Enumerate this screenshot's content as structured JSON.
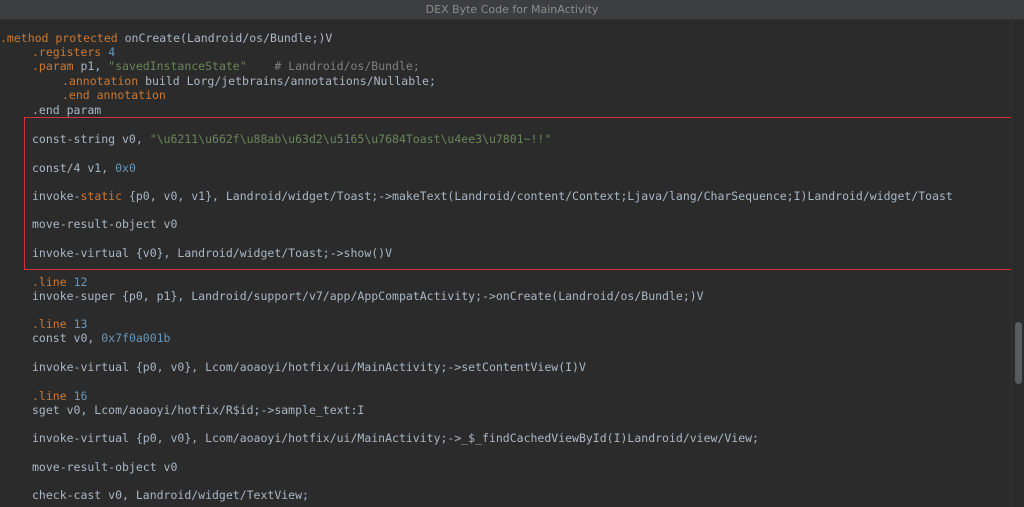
{
  "window": {
    "title": "DEX Byte Code for MainActivity"
  },
  "code": {
    "l1": {
      "dir": ".method protected",
      "rest": " onCreate(Landroid/os/Bundle;)V"
    },
    "l2": {
      "dir": ".registers",
      "num": "4"
    },
    "l3": {
      "dir": ".param",
      "rest": " p1, ",
      "str": "\"savedInstanceState\"",
      "cmt": "    # Landroid/os/Bundle;"
    },
    "l4": {
      "dir": ".annotation",
      "rest": " build Lorg/jetbrains/annotations/Nullable;"
    },
    "l5": {
      "dir": ".end annotation"
    },
    "l6": {
      "text": ".end param"
    },
    "l7": {
      "rest": "const-string v0, ",
      "str": "\"\\u6211\\u662f\\u88ab\\u63d2\\u5165\\u7684Toast\\u4ee3\\u7801~!!\""
    },
    "l8": {
      "rest": "const/4 v1, ",
      "num": "0x0"
    },
    "l9": {
      "pre": "invoke-",
      "kw": "static",
      "rest": " {p0, v0, v1}, Landroid/widget/Toast;->makeText(Landroid/content/Context;Ljava/lang/CharSequence;I)Landroid/widget/Toast"
    },
    "l10": {
      "text": "move-result-object v0"
    },
    "l11": {
      "text": "invoke-virtual {v0}, Landroid/widget/Toast;->show()V"
    },
    "l12": {
      "dir": ".line",
      "num": "12"
    },
    "l13": {
      "text": "invoke-super {p0, p1}, Landroid/support/v7/app/AppCompatActivity;->onCreate(Landroid/os/Bundle;)V"
    },
    "l14": {
      "dir": ".line",
      "num": "13"
    },
    "l15": {
      "rest": "const v0, ",
      "num": "0x7f0a001b"
    },
    "l16": {
      "text": "invoke-virtual {p0, v0}, Lcom/aoaoyi/hotfix/ui/MainActivity;->setContentView(I)V"
    },
    "l17": {
      "dir": ".line",
      "num": "16"
    },
    "l18": {
      "text": "sget v0, Lcom/aoaoyi/hotfix/R$id;->sample_text:I"
    },
    "l19": {
      "text": "invoke-virtual {p0, v0}, Lcom/aoaoyi/hotfix/ui/MainActivity;->_$_findCachedViewById(I)Landroid/view/View;"
    },
    "l20": {
      "text": "move-result-object v0"
    },
    "l21": {
      "text": "check-cast v0, Landroid/widget/TextView;"
    }
  },
  "colors": {
    "background": "#2b2b2b",
    "keyword": "#cc7832",
    "string": "#6a8759",
    "number": "#6897bb",
    "comment": "#808080",
    "highlight_border": "#d1333b"
  }
}
